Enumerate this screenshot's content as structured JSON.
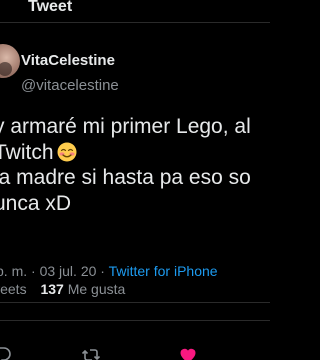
{
  "header": {
    "title": "Tweet"
  },
  "author": {
    "display_name": "VitaCelestine",
    "handle": "@vitacelestine"
  },
  "tweet": {
    "lines": [
      "y armaré mi primer Lego, al",
      "Twitch",
      "la madre si hasta pa eso so",
      "unca xD"
    ],
    "emoji_icon": "smiling-face-with-blush-icon"
  },
  "meta": {
    "time": "p. m.",
    "separator": "·",
    "date": "03 jul. 20",
    "source": "Twitter for iPhone"
  },
  "stats": {
    "retweets_label": "weets",
    "likes_count": "137",
    "likes_label": "Me gusta"
  },
  "actions": {
    "reply_icon": "reply-icon",
    "retweet_icon": "retweet-icon",
    "like_icon": "heart-icon"
  },
  "colors": {
    "background": "#000000",
    "text": "#e7e9ea",
    "muted": "#8b9095",
    "link": "#1d9bf0",
    "like": "#f91880"
  }
}
